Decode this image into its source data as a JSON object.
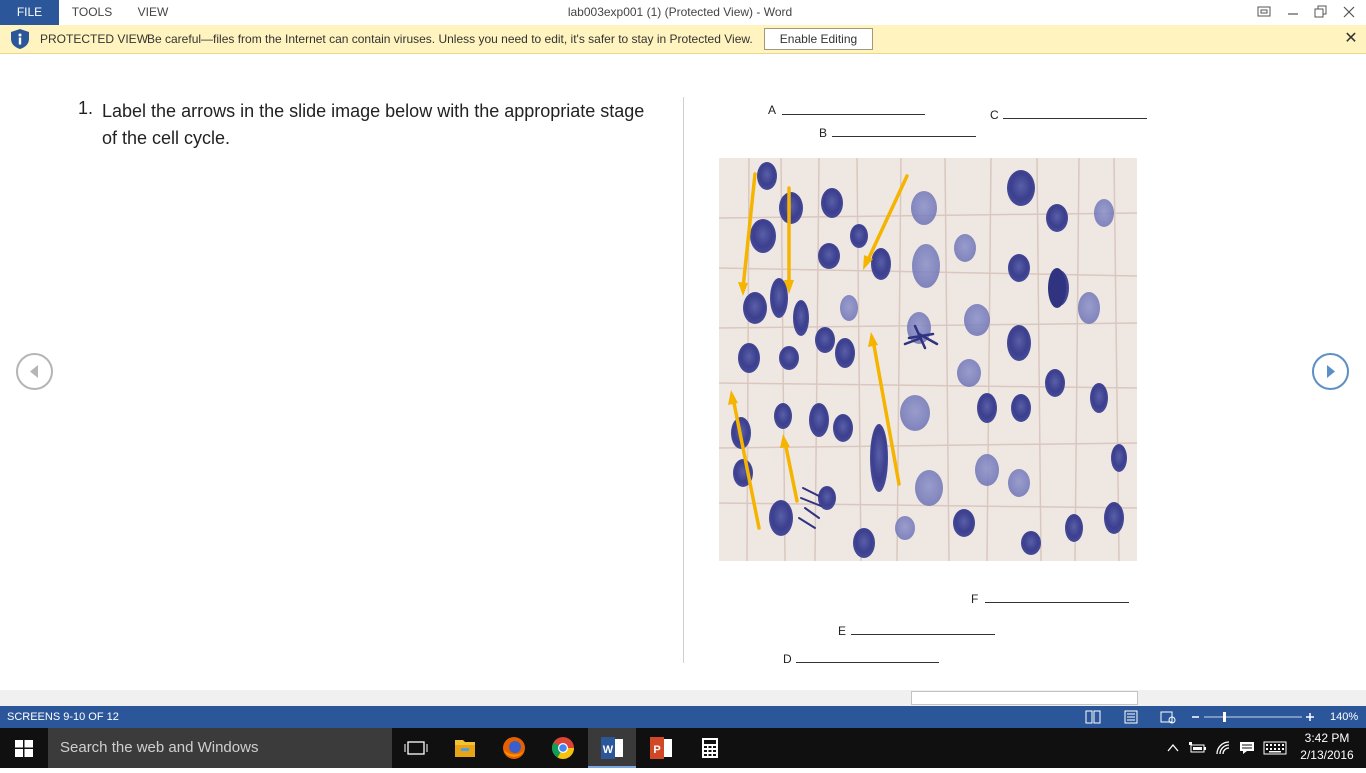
{
  "ribbon": {
    "tabs": [
      {
        "label": "FILE",
        "active": true
      },
      {
        "label": "TOOLS",
        "active": false
      },
      {
        "label": "VIEW",
        "active": false
      }
    ],
    "window_title": "lab003exp001 (1) (Protected View) - Word"
  },
  "protected_view": {
    "title": "PROTECTED VIEW",
    "message": "Be careful—files from the Internet can contain viruses. Unless you need to edit, it's safer to stay in Protected View.",
    "button_label": "Enable Editing",
    "close_glyph": "✕"
  },
  "document": {
    "question_number": "1.",
    "question_text": "Label the arrows in the slide image below with the appropriate stage of the cell cycle.",
    "labels": {
      "a": "A",
      "b": "B",
      "c": "C",
      "d": "D",
      "e": "E",
      "f": "F"
    }
  },
  "status": {
    "screens": "SCREENS 9-10 OF 12",
    "zoom": "140%"
  },
  "taskbar": {
    "search_placeholder": "Search the web and Windows",
    "time": "3:42 PM",
    "date": "2/13/2016"
  },
  "colors": {
    "accent": "#2b579a",
    "protected_bar": "#fff4bf",
    "arrow": "#f5b400",
    "taskbar": "#101010"
  },
  "icons": [
    "shield-info-icon",
    "restore-icon",
    "minimize-icon",
    "maximize-icon",
    "close-icon",
    "start-icon",
    "task-view-icon",
    "file-explorer-icon",
    "firefox-icon",
    "chrome-icon",
    "word-icon",
    "powerpoint-icon",
    "calculator-icon"
  ]
}
